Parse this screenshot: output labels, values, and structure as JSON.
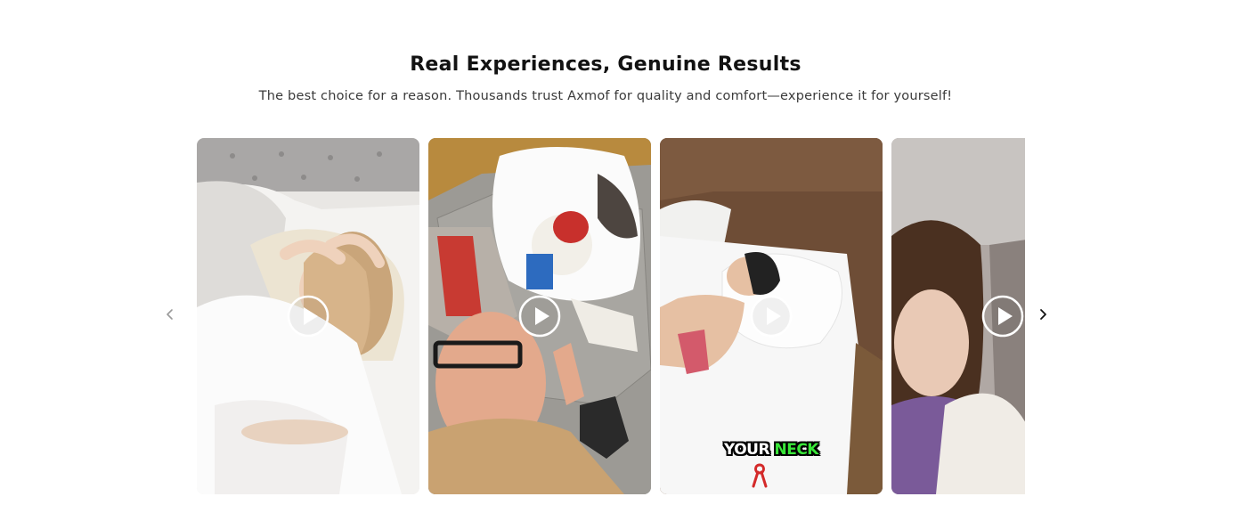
{
  "section": {
    "title": "Real Experiences, Genuine Results",
    "subtitle": "The best choice for a reason. Thousands trust Axmof for quality and comfort—experience it for yourself!"
  },
  "carousel": {
    "prev_icon": "chevron-left-icon",
    "next_icon": "chevron-right-icon",
    "colors": {
      "prev_arrow": "#9a9a9a",
      "next_arrow": "#121212",
      "play_ring": "#ffffff"
    },
    "videos": [
      {
        "play_icon": "play-icon"
      },
      {
        "play_icon": "play-icon"
      },
      {
        "play_icon": "play-icon",
        "caption_white": "YOUR",
        "caption_green": "NECK"
      },
      {
        "play_icon": "play-icon"
      }
    ]
  }
}
